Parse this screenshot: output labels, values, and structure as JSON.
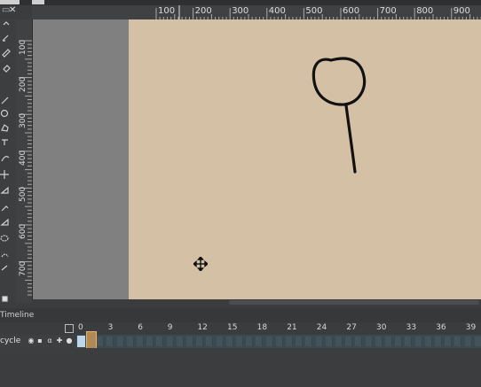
{
  "panel": {
    "close_glyph": "✕",
    "undock_glyph": "▭"
  },
  "ruler_h": {
    "labels": [
      "100",
      "200",
      "300",
      "400",
      "500",
      "600",
      "700",
      "800",
      "900"
    ]
  },
  "ruler_v": {
    "labels": [
      "100",
      "200",
      "300",
      "400",
      "500",
      "600",
      "700"
    ]
  },
  "timeline": {
    "title": "Timeline",
    "frame_labels": [
      "0",
      "3",
      "6",
      "9",
      "12",
      "15",
      "18",
      "21",
      "24",
      "27",
      "30",
      "33",
      "36",
      "39"
    ],
    "layer": {
      "name": "cycle",
      "alpha_glyph": "α"
    }
  },
  "tools": {
    "icons": [
      "transform-icon",
      "brush-icon",
      "pencil-icon",
      "fill-icon",
      "line-icon",
      "circle-icon",
      "polygon-icon",
      "text-icon",
      "gradient-icon",
      "move-icon",
      "skew-icon",
      "eyedropper-icon",
      "ruler-icon",
      "lasso-icon",
      "magic-wand-icon",
      "hand-icon"
    ]
  },
  "colors": {
    "canvas": "#d4c0a4",
    "workspace": "#808080",
    "frame_cell": "#445259",
    "playhead": "#b08a52",
    "current_frame": "#bcd6ec"
  }
}
